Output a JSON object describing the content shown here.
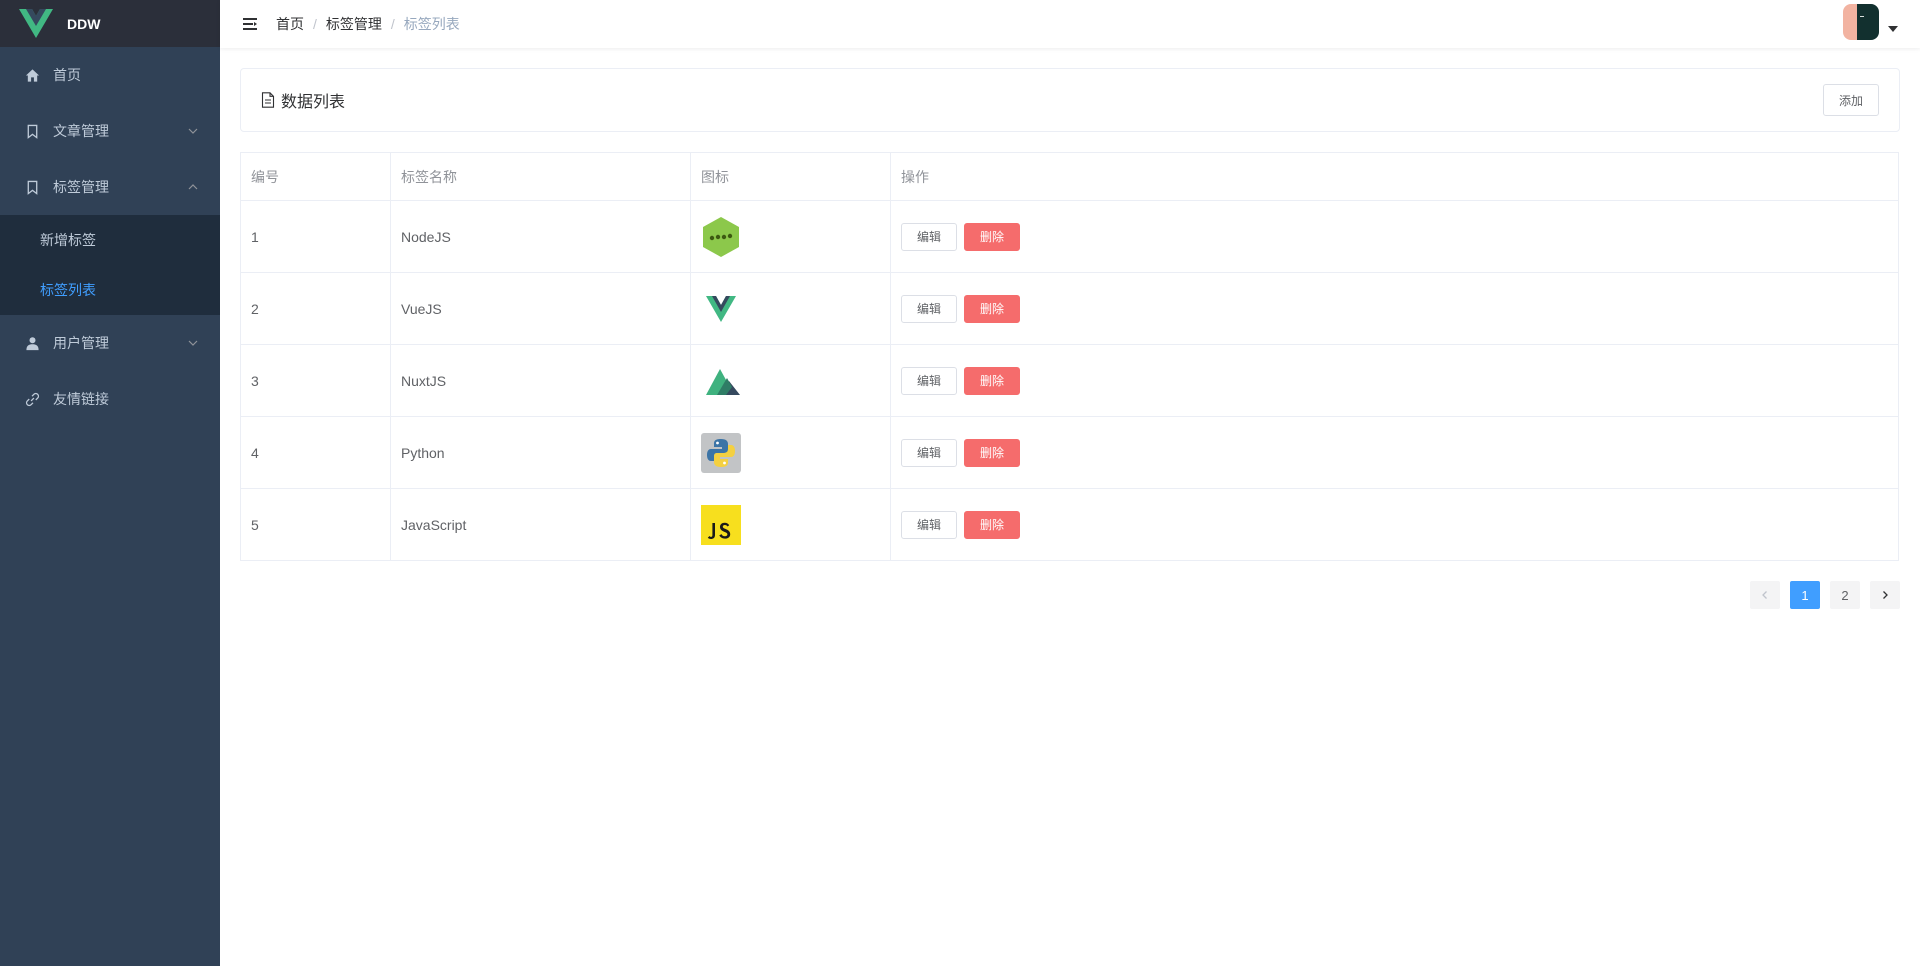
{
  "app": {
    "name": "DDW"
  },
  "sidebar": {
    "items": [
      {
        "label": "首页",
        "icon": "home-icon"
      },
      {
        "label": "文章管理",
        "icon": "bookmark-icon",
        "expanded": false
      },
      {
        "label": "标签管理",
        "icon": "bookmark-icon",
        "expanded": true,
        "children": [
          {
            "label": "新增标签",
            "active": false
          },
          {
            "label": "标签列表",
            "active": true
          }
        ]
      },
      {
        "label": "用户管理",
        "icon": "user-icon",
        "expanded": false
      },
      {
        "label": "友情链接",
        "icon": "link-icon"
      }
    ]
  },
  "header": {
    "breadcrumb": [
      "首页",
      "标签管理",
      "标签列表"
    ],
    "separator": "/"
  },
  "panel": {
    "title": "数据列表",
    "add_label": "添加"
  },
  "table": {
    "columns": [
      "编号",
      "标签名称",
      "图标",
      "操作"
    ],
    "rows": [
      {
        "id": "1",
        "name": "NodeJS",
        "icon": "nodejs-icon"
      },
      {
        "id": "2",
        "name": "VueJS",
        "icon": "vuejs-icon"
      },
      {
        "id": "3",
        "name": "NuxtJS",
        "icon": "nuxtjs-icon"
      },
      {
        "id": "4",
        "name": "Python",
        "icon": "python-icon"
      },
      {
        "id": "5",
        "name": "JavaScript",
        "icon": "javascript-icon"
      }
    ],
    "edit_label": "编辑",
    "delete_label": "删除"
  },
  "pagination": {
    "pages": [
      "1",
      "2"
    ],
    "current": "1"
  },
  "colors": {
    "sidebar_bg": "#304156",
    "active": "#409eff",
    "danger": "#f56c6c",
    "vue_green": "#41b883"
  }
}
